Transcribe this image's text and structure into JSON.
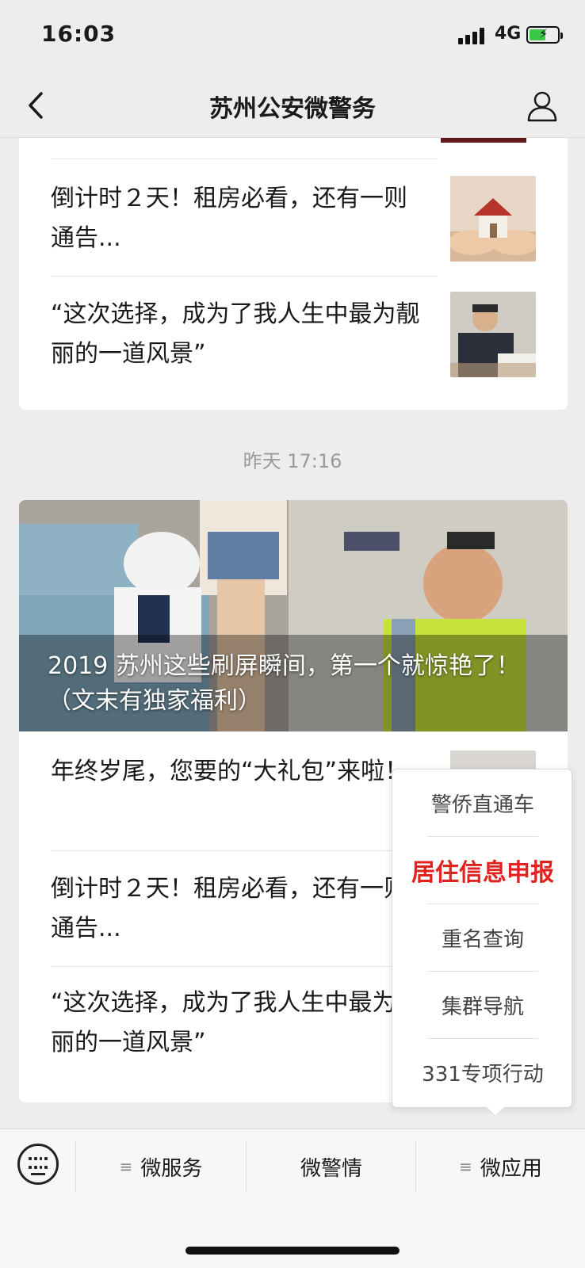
{
  "status_bar": {
    "time": "16:03",
    "network": "4G",
    "battery_charging": true
  },
  "nav": {
    "title": "苏州公安微警务",
    "back_icon": "chevron-left-icon",
    "profile_icon": "person-icon"
  },
  "feed": {
    "group_1": {
      "items": [
        {
          "title": "倒计时２天！租房必看，还有一则通告..."
        },
        {
          "title": "“这次选择，成为了我人生中最为靓丽的一道风景”"
        }
      ]
    },
    "timestamp": "昨天 17:16",
    "group_2": {
      "hero_title": "2019 苏州这些刷屏瞬间，第一个就惊艳了！（文末有独家福利）",
      "items": [
        {
          "title": "年终岁尾，您要的“大礼包”来啦！"
        },
        {
          "title": "倒计时２天！租房必看，还有一则通告..."
        },
        {
          "title": "“这次选择，成为了我人生中最为靓丽的一道风景”"
        }
      ]
    }
  },
  "popup_menu": {
    "items": [
      {
        "label": "警侨直通车"
      },
      {
        "label": "居住信息申报",
        "highlight": true
      },
      {
        "label": "重名查询"
      },
      {
        "label": "集群导航"
      },
      {
        "label": "331专项行动"
      }
    ]
  },
  "bottom_menu": {
    "keyboard_icon": "keyboard-icon",
    "items": [
      {
        "label": "微服务",
        "has_submenu": true
      },
      {
        "label": "微警情",
        "has_submenu": false
      },
      {
        "label": "微应用",
        "has_submenu": true
      }
    ]
  },
  "colors": {
    "background": "#ededed",
    "highlight_red": "#e0231f"
  }
}
